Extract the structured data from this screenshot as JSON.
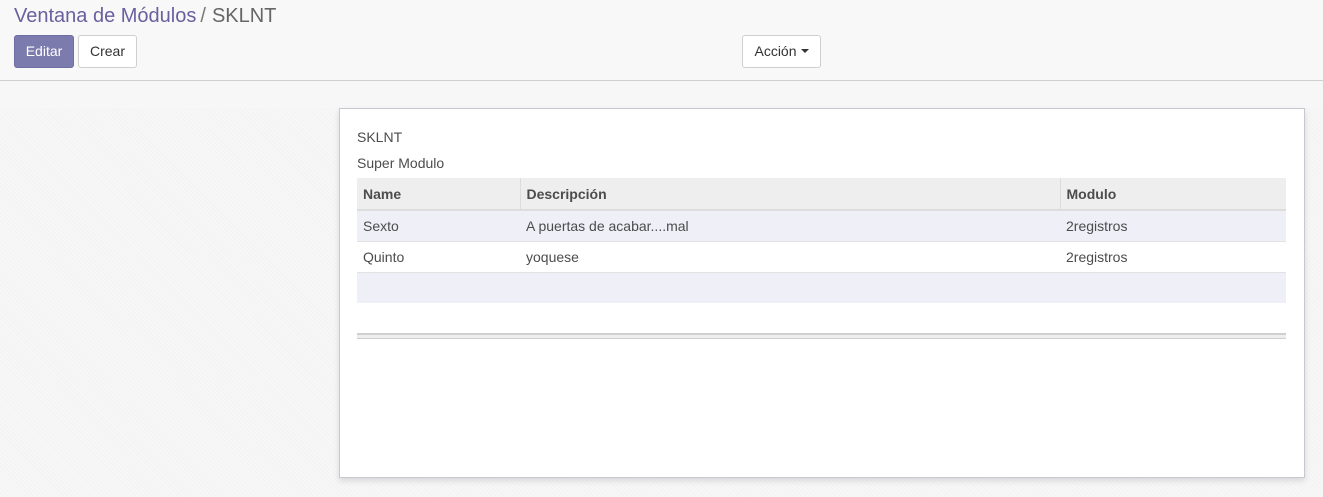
{
  "breadcrumb": {
    "parent": "Ventana de Módulos",
    "separator": "/",
    "current": "SKLNT"
  },
  "toolbar": {
    "edit_label": "Editar",
    "create_label": "Crear",
    "action_label": "Acción"
  },
  "record": {
    "name": "SKLNT",
    "subtitle": "Super Modulo"
  },
  "table": {
    "columns": [
      "Name",
      "Descripción",
      "Modulo"
    ],
    "rows": [
      {
        "name": "Sexto",
        "descripcion": "A puertas de acabar....mal",
        "modulo": "2registros"
      },
      {
        "name": "Quinto",
        "descripcion": "yoquese",
        "modulo": "2registros"
      }
    ]
  },
  "colors": {
    "primary": "#7c7bad",
    "breadcrumb_link": "#6b5f9d",
    "row_stripe": "#efeff8"
  },
  "icons": {
    "action_dropdown": "caret-down-icon"
  }
}
